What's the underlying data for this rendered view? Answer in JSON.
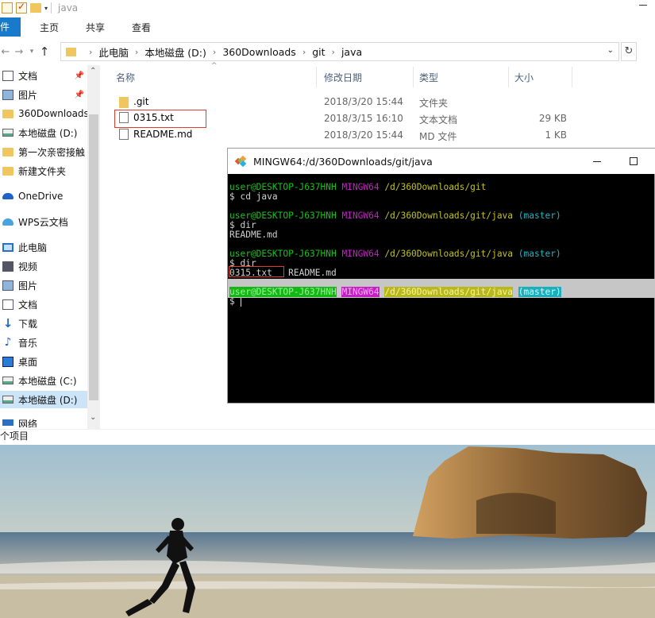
{
  "explorer": {
    "window_title": "java",
    "ribbon": {
      "file_tab": "件",
      "tabs": [
        "主页",
        "共享",
        "查看"
      ]
    },
    "address": {
      "crumbs": [
        "此电脑",
        "本地磁盘 (D:)",
        "360Downloads",
        "git",
        "java"
      ]
    },
    "nav": {
      "items": [
        {
          "label": "文档",
          "icon": "document-icon",
          "pinned": true
        },
        {
          "label": "图片",
          "icon": "pictures-icon",
          "pinned": true
        },
        {
          "label": "360Downloads",
          "icon": "folder-icon"
        },
        {
          "label": "本地磁盘 (D:)",
          "icon": "drive-icon"
        },
        {
          "label": "第一次亲密接触",
          "icon": "folder-icon"
        },
        {
          "label": "新建文件夹",
          "icon": "folder-icon"
        },
        {
          "label": "OneDrive",
          "icon": "onedrive-icon"
        },
        {
          "label": "WPS云文档",
          "icon": "wps-cloud-icon"
        },
        {
          "label": "此电脑",
          "icon": "computer-icon"
        },
        {
          "label": "视频",
          "icon": "video-icon"
        },
        {
          "label": "图片",
          "icon": "pictures-icon"
        },
        {
          "label": "文档",
          "icon": "document-icon"
        },
        {
          "label": "下载",
          "icon": "download-icon"
        },
        {
          "label": "音乐",
          "icon": "music-icon"
        },
        {
          "label": "桌面",
          "icon": "desktop-icon"
        },
        {
          "label": "本地磁盘 (C:)",
          "icon": "drive-icon"
        },
        {
          "label": "本地磁盘 (D:)",
          "icon": "drive-icon",
          "selected": true
        },
        {
          "label": "网络",
          "icon": "network-icon"
        }
      ]
    },
    "columns": {
      "name": "名称",
      "modified": "修改日期",
      "type": "类型",
      "size": "大小"
    },
    "files": [
      {
        "name": ".git",
        "modified": "2018/3/20 15:44",
        "type": "文件夹",
        "size": "",
        "icon": "folder-icon"
      },
      {
        "name": "0315.txt",
        "modified": "2018/3/15 16:10",
        "type": "文本文档",
        "size": "29 KB",
        "icon": "text-file-icon"
      },
      {
        "name": "README.md",
        "modified": "2018/3/20 15:44",
        "type": "MD 文件",
        "size": "1 KB",
        "icon": "text-file-icon"
      }
    ],
    "status": "个项目"
  },
  "terminal": {
    "title": "MINGW64:/d/360Downloads/git/java",
    "user_host": "user@DESKTOP-J637HNH",
    "shell": "MINGW64",
    "lines": {
      "p1_path": "/d/360Downloads/git",
      "cmd1": "$ cd java",
      "p2_path": "/d/360Downloads/git/java",
      "branch": "(master)",
      "cmd2": "$ dir",
      "out2": "README.md",
      "cmd3": "$ dir",
      "out3_file1": "0315.txt",
      "out3_file2": "README.md",
      "prompt": "$"
    }
  },
  "colors": {
    "accent": "#1979ca",
    "highlight_box": "#e03c31",
    "terminal_bg": "#000000",
    "prompt_green": "#18c218",
    "prompt_magenta": "#c81fc8",
    "prompt_yellow": "#c2c21c",
    "prompt_cyan": "#1cb6c2"
  }
}
